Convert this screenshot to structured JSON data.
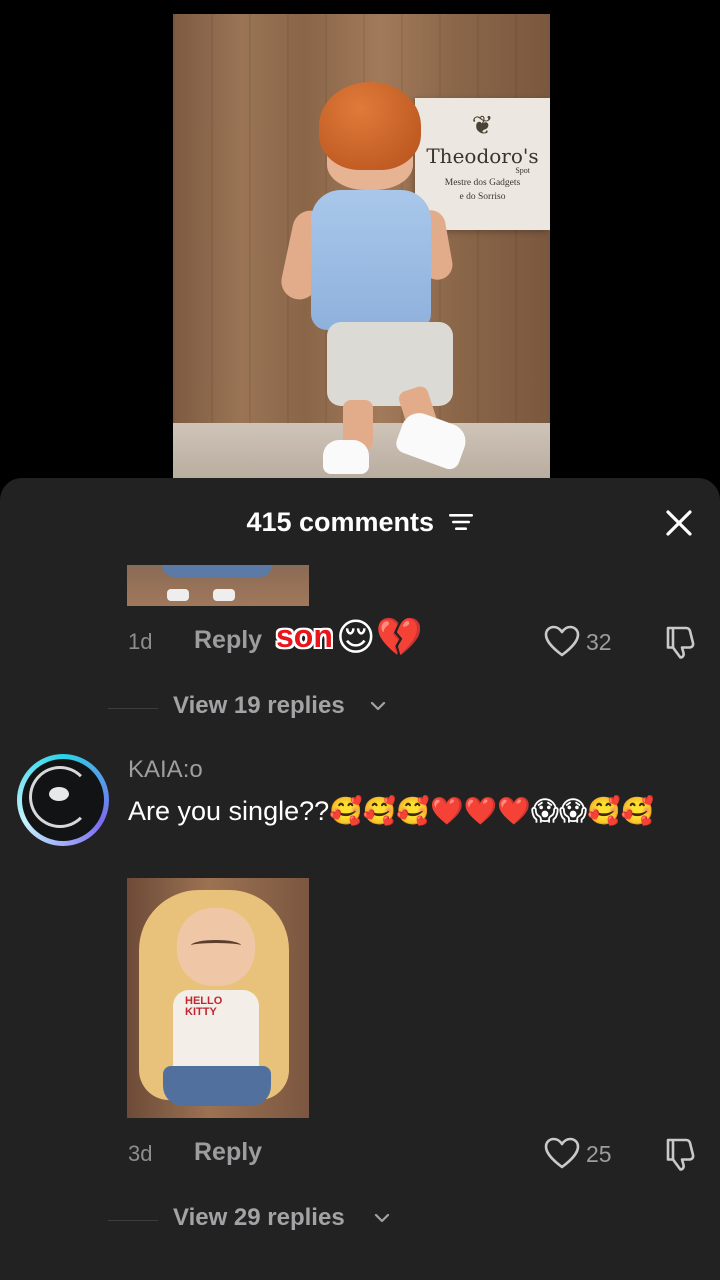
{
  "video": {
    "sign_title": "Theodoro's",
    "sign_spot": "Spot",
    "sign_line1": "Mestre dos Gadgets",
    "sign_line2": "e do Sorriso"
  },
  "comments_panel": {
    "title": "415 comments",
    "sort_icon": "sort-lines-icon",
    "close_icon": "close-icon"
  },
  "comments": [
    {
      "time": "1d",
      "reply_label": "Reply",
      "likes": "32",
      "view_replies": "View 19 replies"
    },
    {
      "username": "KAIA:o",
      "text": "Are you single??🥰🥰🥰❤️❤️❤️😱😱🥰🥰",
      "time": "3d",
      "reply_label": "Reply",
      "likes": "25",
      "view_replies": "View 29 replies"
    }
  ],
  "overlay": {
    "text": "son",
    "emoji": "😌💔"
  },
  "colors": {
    "sheet_bg": "#222223",
    "muted_text": "#9d9d9f",
    "overlay_red": "#e8151b"
  }
}
